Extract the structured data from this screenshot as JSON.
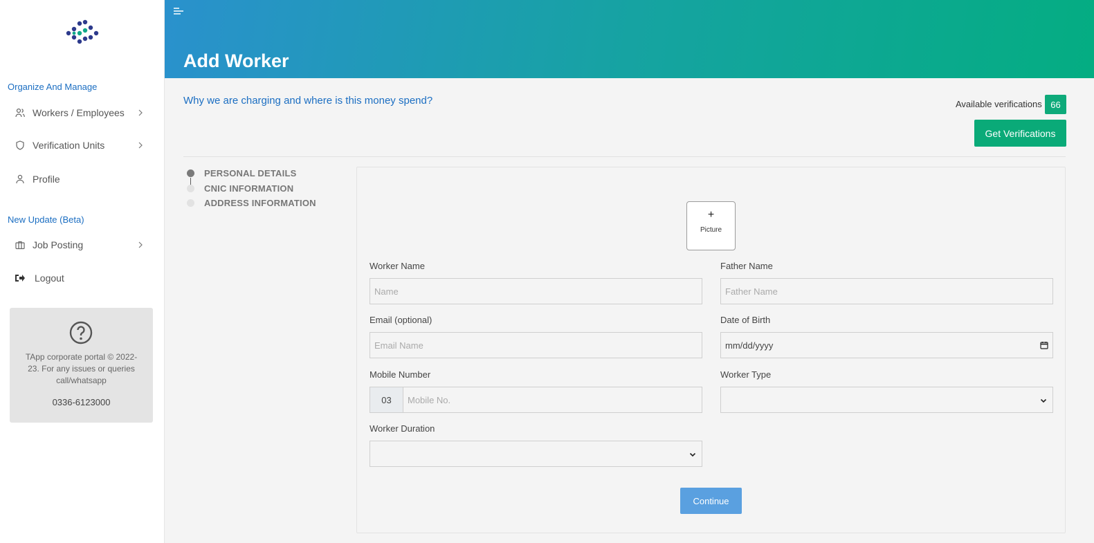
{
  "sidebar": {
    "section1_label": "Organize And Manage",
    "items": [
      {
        "label": "Workers / Employees",
        "icon": "users-icon"
      },
      {
        "label": "Verification Units",
        "icon": "shield-icon"
      },
      {
        "label": "Profile",
        "icon": "user-icon"
      }
    ],
    "section2_label": "New Update (Beta)",
    "items2": [
      {
        "label": "Job Posting",
        "icon": "briefcase-icon"
      },
      {
        "label": "Logout",
        "icon": "logout-icon"
      }
    ],
    "help": {
      "text": "TApp corporate portal © 2022-23. For any issues or queries call/whatsapp",
      "phone": "0336-6123000"
    }
  },
  "header": {
    "title": "Add Worker"
  },
  "main": {
    "charge_link": "Why we are charging and where is this money spend?",
    "available_label": "Available verifications",
    "available_count": "66",
    "get_verifications_label": "Get Verifications"
  },
  "stepper": [
    {
      "label": "PERSONAL DETAILS",
      "active": true
    },
    {
      "label": "CNIC INFORMATION",
      "active": false
    },
    {
      "label": "ADDRESS INFORMATION",
      "active": false
    }
  ],
  "form": {
    "picture": {
      "plus": "+",
      "label": "Picture"
    },
    "worker_name": {
      "label": "Worker Name",
      "placeholder": "Name"
    },
    "father_name": {
      "label": "Father Name",
      "placeholder": "Father Name"
    },
    "email": {
      "label": "Email (optional)",
      "placeholder": "Email Name"
    },
    "dob": {
      "label": "Date of Birth",
      "value": "mm/dd/yyyy"
    },
    "mobile": {
      "label": "Mobile Number",
      "prefix": "03",
      "placeholder": "Mobile No."
    },
    "worker_type": {
      "label": "Worker Type",
      "value": ""
    },
    "worker_duration": {
      "label": "Worker Duration",
      "value": ""
    },
    "continue_label": "Continue"
  },
  "colors": {
    "accent_blue": "#1b6ec2",
    "accent_green": "#0aaa78",
    "header_gradient_start": "#2a91cd",
    "header_gradient_end": "#04ad82",
    "continue_button": "#5aa0e0"
  }
}
